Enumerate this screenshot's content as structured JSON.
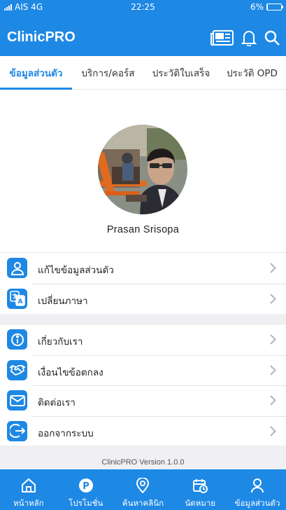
{
  "status_bar": {
    "carrier": "AIS 4G",
    "time": "22:25",
    "battery": "6%",
    "battery_level": 0.06
  },
  "app": {
    "title": "ClinicPRO",
    "icons": [
      "news-icon",
      "bell-icon",
      "search-icon"
    ]
  },
  "tabs": [
    {
      "label": "ข้อมูลส่วนตัว",
      "active": true
    },
    {
      "label": "บริการ/คอร์ส",
      "active": false
    },
    {
      "label": "ประวัติใบเสร็จ",
      "active": false
    },
    {
      "label": "ประวัติ OPD",
      "active": false
    }
  ],
  "profile": {
    "name": "Prasan Srisopa"
  },
  "menu_group_1": [
    {
      "label": "แก้ไขข้อมูลส่วนตัว",
      "icon": "person-icon"
    },
    {
      "label": "เปลี่ยนภาษา",
      "icon": "translate-icon"
    }
  ],
  "menu_group_2": [
    {
      "label": "เกี่ยวกับเรา",
      "icon": "info-icon"
    },
    {
      "label": "เงื่อนไขข้อตกลง",
      "icon": "handshake-icon"
    },
    {
      "label": "ติดต่อเรา",
      "icon": "mail-icon"
    },
    {
      "label": "ออกจากระบบ",
      "icon": "logout-icon"
    }
  ],
  "version": "ClinicPRO Version 1.0.0",
  "bottom_nav": [
    {
      "label": "หน้าหลัก",
      "icon": "home-icon"
    },
    {
      "label": "โปรโมชั่น",
      "icon": "promotion-icon"
    },
    {
      "label": "ค้นหาคลินิก",
      "icon": "location-pin-icon"
    },
    {
      "label": "นัดหมาย",
      "icon": "calendar-icon"
    },
    {
      "label": "ข้อมูลส่วนตัว",
      "icon": "profile-icon"
    }
  ],
  "colors": {
    "primary": "#1e88e5",
    "background_gray": "#efeff4"
  }
}
